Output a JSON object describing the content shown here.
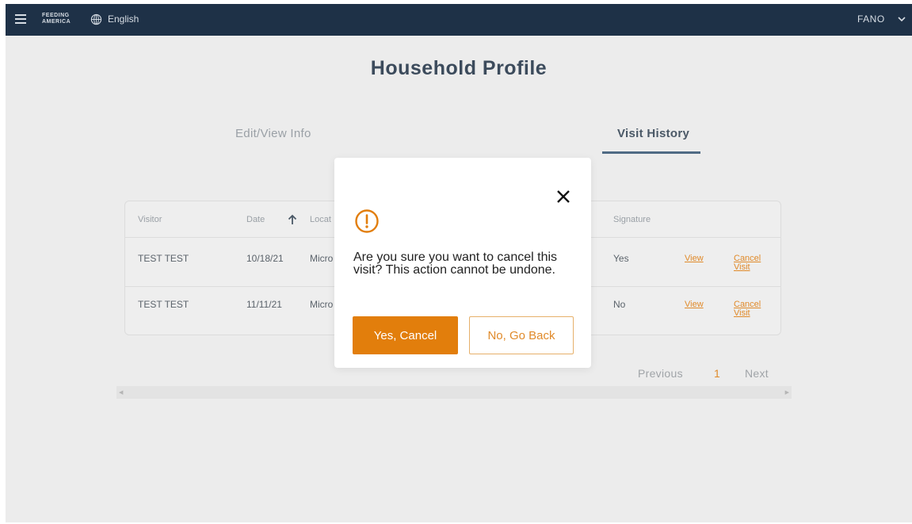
{
  "nav": {
    "logo_line1": "FEEDING",
    "logo_line2": "AMERICA",
    "language": "English",
    "user": "FANO"
  },
  "page": {
    "title": "Household Profile",
    "tabs": [
      {
        "label": "Edit/View Info",
        "active": false
      },
      {
        "label": "Visit History",
        "active": true
      }
    ]
  },
  "table": {
    "columns": [
      "Visitor",
      "Date",
      "Locat",
      "Signature"
    ],
    "rows": [
      {
        "visitor": "TEST TEST",
        "date": "10/18/21",
        "location": "Micro",
        "signature": "Yes",
        "view": "View",
        "cancel_line1": "Cancel",
        "cancel_line2": "Visit"
      },
      {
        "visitor": "TEST TEST",
        "date": "11/11/21",
        "location": "Micro",
        "signature": "No",
        "view": "View",
        "cancel_line1": "Cancel",
        "cancel_line2": "Visit"
      }
    ]
  },
  "pagination": {
    "previous": "Previous",
    "current": "1",
    "next": "Next"
  },
  "modal": {
    "message": "Are you sure you want to cancel this visit? This action cannot be undone.",
    "confirm_label": "Yes, Cancel",
    "back_label": "No, Go Back"
  },
  "colors": {
    "nav_bg": "#1e3147",
    "accent": "#e27e0c",
    "tab_underline": "#4f6a84",
    "page_bg": "#ececec"
  },
  "icons": [
    "menu-icon",
    "globe-icon",
    "chevron-down-icon",
    "sort-up-arrow-icon",
    "close-icon",
    "warning-icon"
  ]
}
